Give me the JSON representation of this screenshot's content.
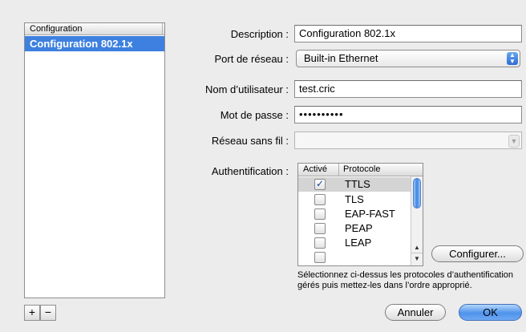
{
  "config_list": {
    "header": "Configuration",
    "items": [
      "Configuration 802.1x"
    ],
    "add_label": "+",
    "remove_label": "−"
  },
  "form": {
    "description_label": "Description :",
    "description_value": "Configuration 802.1x",
    "port_label": "Port de réseau :",
    "port_value": "Built-in Ethernet",
    "username_label": "Nom d’utilisateur :",
    "username_value": "test.cric",
    "password_label": "Mot de passe :",
    "password_value": "••••••••••",
    "wireless_label": "Réseau sans fil :",
    "wireless_value": "",
    "auth_label": "Authentification :"
  },
  "auth_table": {
    "col_enabled": "Activé",
    "col_protocol": "Protocole",
    "rows": [
      {
        "protocol": "TTLS",
        "enabled": true
      },
      {
        "protocol": "TLS",
        "enabled": false
      },
      {
        "protocol": "EAP-FAST",
        "enabled": false
      },
      {
        "protocol": "PEAP",
        "enabled": false
      },
      {
        "protocol": "LEAP",
        "enabled": false
      }
    ]
  },
  "buttons": {
    "configure": "Configurer...",
    "cancel": "Annuler",
    "ok": "OK"
  },
  "help_text": "Sélectionnez ci-dessus les protocoles d’authentification gérés puis mettez-les dans l’ordre approprié.",
  "icons": {
    "checkbox_checked": "check-icon",
    "popup": "popup-arrows-icon",
    "scroll_up": "arrow-up-icon",
    "scroll_down": "arrow-down-icon"
  },
  "colors": {
    "selection": "#3d80df",
    "default_button": "#4e93ec"
  }
}
